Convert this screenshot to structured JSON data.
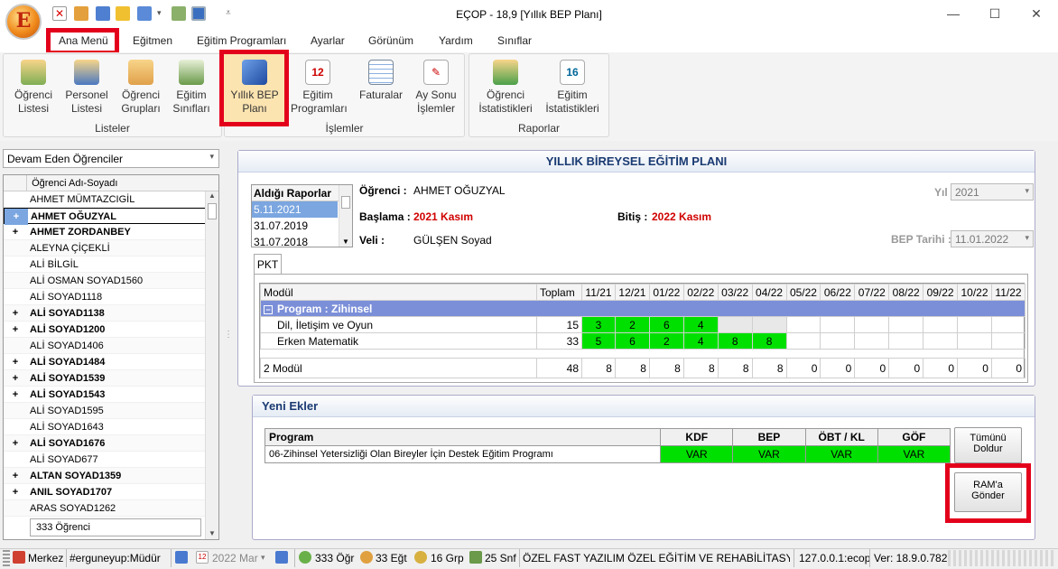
{
  "window": {
    "title": "EÇOP - 18,9 [Yıllık BEP Planı]",
    "orb_letter": "E"
  },
  "menu": {
    "tabs": [
      "Ana Menü",
      "Eğitmen",
      "Eğitim Programları",
      "Ayarlar",
      "Görünüm",
      "Yardım",
      "Sınıflar"
    ],
    "active": "Ana Menü"
  },
  "ribbon": {
    "groups": [
      {
        "label": "Listeler",
        "buttons": [
          "Öğrenci\nListesi",
          "Personel\nListesi",
          "Öğrenci\nGrupları",
          "Eğitim\nSınıfları"
        ]
      },
      {
        "label": "İşlemler",
        "buttons": [
          "Yıllık BEP\nPlanı",
          "Eğitim\nProgramları",
          "Faturalar",
          "Ay Sonu\nİşlemler"
        ]
      },
      {
        "label": "Raporlar",
        "buttons": [
          "Öğrenci\nİstatistikleri",
          "Eğitim\nİstatistikleri"
        ]
      }
    ]
  },
  "student_list": {
    "filter": "Devam Eden Öğrenciler",
    "header": "Öğrenci Adı-Soyadı",
    "rows": [
      {
        "exp": "",
        "name": "AHMET MÜMTAZCIGİL",
        "bold": false
      },
      {
        "exp": "+",
        "name": "AHMET OĞUZYAL",
        "bold": true
      },
      {
        "exp": "+",
        "name": "AHMET ZORDANBEY",
        "bold": true
      },
      {
        "exp": "",
        "name": "ALEYNA ÇİÇEKLİ",
        "bold": false
      },
      {
        "exp": "",
        "name": "ALİ BİLGİL",
        "bold": false
      },
      {
        "exp": "",
        "name": "ALİ OSMAN SOYAD1560",
        "bold": false
      },
      {
        "exp": "",
        "name": "ALİ SOYAD1118",
        "bold": false
      },
      {
        "exp": "+",
        "name": "ALİ SOYAD1138",
        "bold": true
      },
      {
        "exp": "+",
        "name": "ALİ SOYAD1200",
        "bold": true
      },
      {
        "exp": "",
        "name": "ALİ SOYAD1406",
        "bold": false
      },
      {
        "exp": "+",
        "name": "ALİ SOYAD1484",
        "bold": true
      },
      {
        "exp": "+",
        "name": "ALİ SOYAD1539",
        "bold": true
      },
      {
        "exp": "+",
        "name": "ALİ SOYAD1543",
        "bold": true
      },
      {
        "exp": "",
        "name": "ALİ SOYAD1595",
        "bold": false
      },
      {
        "exp": "",
        "name": "ALİ SOYAD1643",
        "bold": false
      },
      {
        "exp": "+",
        "name": "ALİ SOYAD1676",
        "bold": true
      },
      {
        "exp": "",
        "name": "ALİ SOYAD677",
        "bold": false
      },
      {
        "exp": "+",
        "name": "ALTAN SOYAD1359",
        "bold": true
      },
      {
        "exp": "+",
        "name": "ANIL SOYAD1707",
        "bold": true
      },
      {
        "exp": "",
        "name": "ARAS SOYAD1262",
        "bold": false
      }
    ],
    "count": "333 Öğrenci"
  },
  "plan": {
    "title": "YILLIK BİREYSEL EĞİTİM PLANI",
    "reports_header": "Aldığı Raporlar",
    "reports": [
      "5.11.2021",
      "31.07.2019",
      "31.07.2018"
    ],
    "student_label": "Öğrenci :",
    "student": "AHMET OĞUZYAL",
    "start_label": "Başlama :",
    "start": "2021 Kasım",
    "end_label": "Bitiş :",
    "end": "2022 Kasım",
    "guardian_label": "Veli :",
    "guardian": "GÜLŞEN Soyad",
    "year_label": "Yıl :",
    "year": "2021",
    "bep_date_label": "BEP Tarihi :",
    "bep_date": "11.01.2022",
    "tab": "PKT",
    "columns": {
      "modul": "Modül",
      "total": "Toplam",
      "months": [
        "11/21",
        "12/21",
        "01/22",
        "02/22",
        "03/22",
        "04/22",
        "05/22",
        "06/22",
        "07/22",
        "08/22",
        "09/22",
        "10/22",
        "11/22"
      ]
    },
    "program_row": "Program : Zihinsel",
    "modules": [
      {
        "name": "Dil, İletişim ve Oyun",
        "total": "15",
        "values": [
          "3",
          "2",
          "6",
          "4",
          "",
          "",
          "",
          "",
          "",
          "",
          "",
          "",
          ""
        ]
      },
      {
        "name": "Erken Matematik",
        "total": "33",
        "values": [
          "5",
          "6",
          "2",
          "4",
          "8",
          "8",
          "",
          "",
          "",
          "",
          "",
          "",
          ""
        ]
      }
    ],
    "summary": {
      "label": "2 Modül",
      "total": "48",
      "values": [
        "8",
        "8",
        "8",
        "8",
        "8",
        "8",
        "0",
        "0",
        "0",
        "0",
        "0",
        "0",
        "0"
      ]
    }
  },
  "new_additions": {
    "title": "Yeni Ekler",
    "headers": [
      "Program",
      "KDF",
      "BEP",
      "ÖBT / KL",
      "GÖF"
    ],
    "rows": [
      {
        "program": "06-Zihinsel Yetersizliği Olan Bireyler İçin Destek Eğitim Programı",
        "kdf": "VAR",
        "bep": "VAR",
        "obt": "VAR",
        "gof": "VAR"
      }
    ],
    "fill_all_button": "Tümünü\nDoldur",
    "send_ram_button": "RAM'a\nGönder"
  },
  "status": {
    "branch": "Merkez",
    "user": "#erguneyup:Müdür",
    "period": "2022 Mar",
    "students": "333 Öğr",
    "teachers": "33 Eğt",
    "groups": "16 Grp",
    "classes": "25 Snf",
    "institution": "ÖZEL FAST YAZILIM ÖZEL EĞİTİM VE REHABİLİTASYON...",
    "server": "127.0.0.1:ecop",
    "version": "Ver: 18.9.0.782"
  },
  "colors": {
    "accent_red": "#e3001b",
    "green_cell": "#00e000",
    "header_blue": "#1a3a72"
  }
}
